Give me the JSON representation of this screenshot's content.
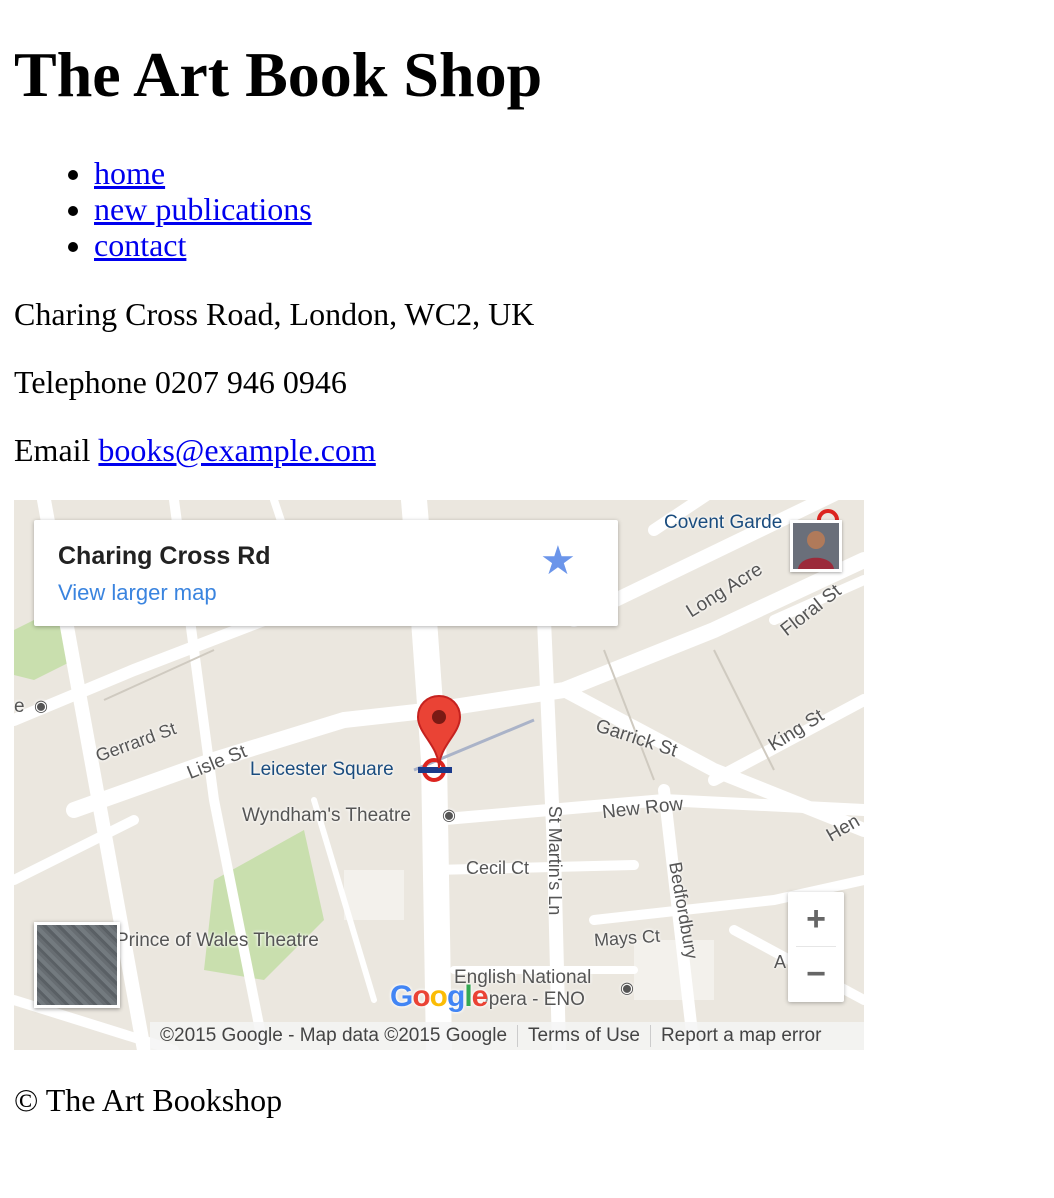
{
  "site": {
    "title": "The Art Book Shop"
  },
  "nav": {
    "items": [
      {
        "label": "home"
      },
      {
        "label": "new publications"
      },
      {
        "label": "contact"
      }
    ]
  },
  "contact": {
    "address": "Charing Cross Road, London, WC2, UK",
    "phone_label": "Telephone 0207 946 0946",
    "email_label": "Email ",
    "email": "books@example.com"
  },
  "map": {
    "card": {
      "place": "Charing Cross Rd",
      "larger_link": "View larger map",
      "star": "★"
    },
    "labels": {
      "covent_garden": "Covent Garde",
      "long_acre": "Long Acre",
      "floral_st": "Floral St",
      "garrick_st": "Garrick St",
      "king_st": "King St",
      "gerrard_st": "Gerrard St",
      "lisle_st": "Lisle St",
      "leicester_square": "Leicester Square",
      "wyndhams": "Wyndham's Theatre",
      "new_row": "New Row",
      "st_martins_ln": "St Martin's Ln",
      "bedfordbury": "Bedfordbury",
      "cecil_ct": "Cecil Ct",
      "mays_ct": "Mays Ct",
      "prince_of_wales": "Prince of Wales Theatre",
      "eno_line1": "English National",
      "eno_line2": "Opera - ENO",
      "hen": "Hen",
      "a_t": "A   T",
      "left_e": "e"
    },
    "zoom_in": "+",
    "zoom_out": "−",
    "logo": {
      "letters": [
        "G",
        "o",
        "o",
        "g",
        "l",
        "e"
      ],
      "colors": [
        "#4285f4",
        "#ea4335",
        "#fbbc05",
        "#4285f4",
        "#34a853",
        "#ea4335"
      ]
    },
    "attribution": {
      "copyright": "©2015 Google - Map data ©2015 Google",
      "terms": "Terms of Use",
      "report": "Report a map error"
    },
    "colors": {
      "land": "#ebe7df",
      "road": "#ffffff",
      "park": "#c9dfae",
      "marker": "#ea4335",
      "tube": "#dc241f"
    }
  },
  "footer": {
    "text": "© The Art Bookshop"
  }
}
